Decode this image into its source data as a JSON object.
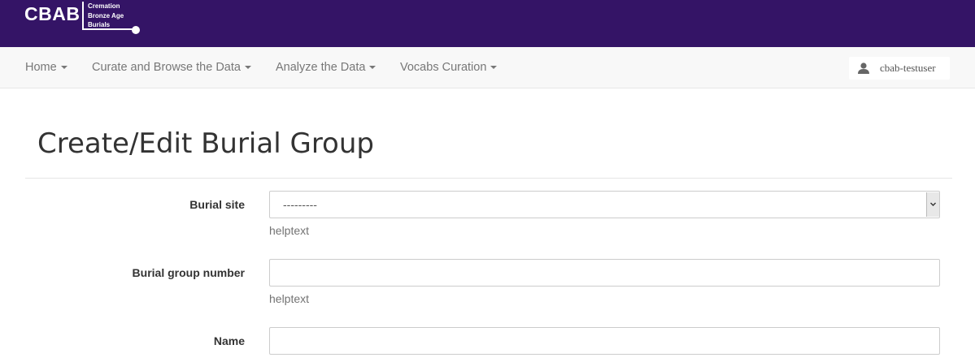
{
  "brand": {
    "abbr": "CBAB",
    "lines": [
      "Cremation",
      "Bronze Age",
      "Burials"
    ],
    "colors": {
      "topbar": "#341466",
      "logo_text": "#ffffff"
    }
  },
  "nav": {
    "items": [
      {
        "label": "Home"
      },
      {
        "label": "Curate and Browse the Data"
      },
      {
        "label": "Analyze the Data"
      },
      {
        "label": "Vocabs Curation"
      }
    ],
    "user": {
      "icon": "user-icon",
      "name": "cbab-testuser"
    }
  },
  "page": {
    "title": "Create/Edit Burial Group"
  },
  "form": {
    "fields": [
      {
        "label": "Burial site",
        "type": "select",
        "value": "---------",
        "helptext": "helptext"
      },
      {
        "label": "Burial group number",
        "type": "text",
        "value": "",
        "helptext": "helptext"
      },
      {
        "label": "Name",
        "type": "text",
        "value": ""
      }
    ]
  }
}
